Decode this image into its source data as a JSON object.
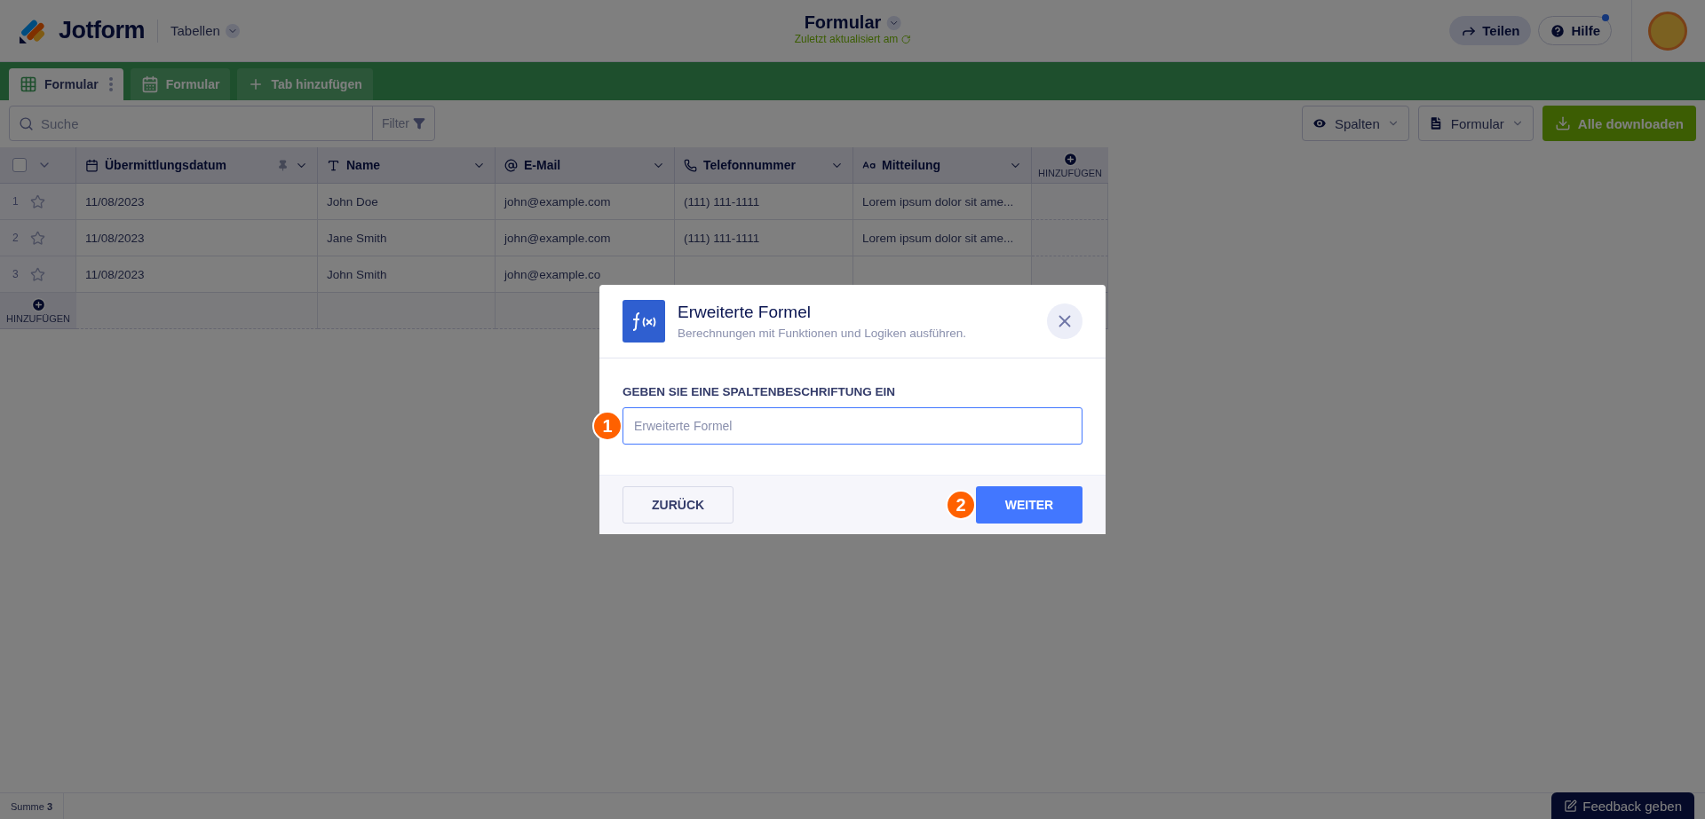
{
  "header": {
    "logo_text": "Jotform",
    "nav": "Tabellen",
    "title": "Formular",
    "subtitle": "Zuletzt aktualisiert am",
    "share": "Teilen",
    "help": "Hilfe",
    "help_notification": true
  },
  "tabs": [
    {
      "label": "Formular",
      "kind": "table",
      "selected": true
    },
    {
      "label": "Formular",
      "kind": "calendar",
      "selected": false
    }
  ],
  "add_tab": "Tab hinzufügen",
  "toolbar": {
    "search": {
      "placeholder": "Suche"
    },
    "filter": "Filter",
    "columns": "Spalten",
    "form": "Formular",
    "download": "Alle downloaden"
  },
  "table": {
    "columns": [
      {
        "label": "Übermittlungsdatum",
        "kind": "date",
        "pinned": true
      },
      {
        "label": "Name",
        "kind": "text",
        "pinned": false
      },
      {
        "label": "E-Mail",
        "kind": "email",
        "pinned": false
      },
      {
        "label": "Telefonnummer",
        "kind": "phone",
        "pinned": false
      },
      {
        "label": "Mitteilung",
        "kind": "textarea",
        "pinned": false
      }
    ],
    "add_column": "HINZUFÜGEN",
    "rows": [
      {
        "number": "1",
        "starred": false,
        "cells": [
          "11/08/2023",
          "John Doe",
          "john@example.com",
          "(111) 111-1111",
          "Lorem ipsum dolor sit ame..."
        ]
      },
      {
        "number": "2",
        "starred": false,
        "cells": [
          "11/08/2023",
          "Jane Smith",
          "john@example.com",
          "(111) 111-1111",
          "Lorem ipsum dolor sit ame..."
        ]
      },
      {
        "number": "3",
        "starred": false,
        "cells": [
          "11/08/2023",
          "John Smith",
          "john@example.co"
        ]
      }
    ],
    "add_row": "HINZUFÜGEN",
    "select_all_checked": false
  },
  "footer": {
    "sum": "Summe **3**",
    "feedback": "Feedback geben"
  },
  "dialog": {
    "title": "Erweiterte Formel",
    "subtitle": "Berechnungen mit Funktionen und Logiken ausführen.",
    "field_label": "GEBEN SIE EINE SPALTENBESCHRIFTUNG EIN",
    "field": {
      "placeholder": "Erweiterte Formel"
    },
    "back": "ZURÜCK",
    "next": "WEITER",
    "steps": [
      "1",
      "2"
    ]
  }
}
